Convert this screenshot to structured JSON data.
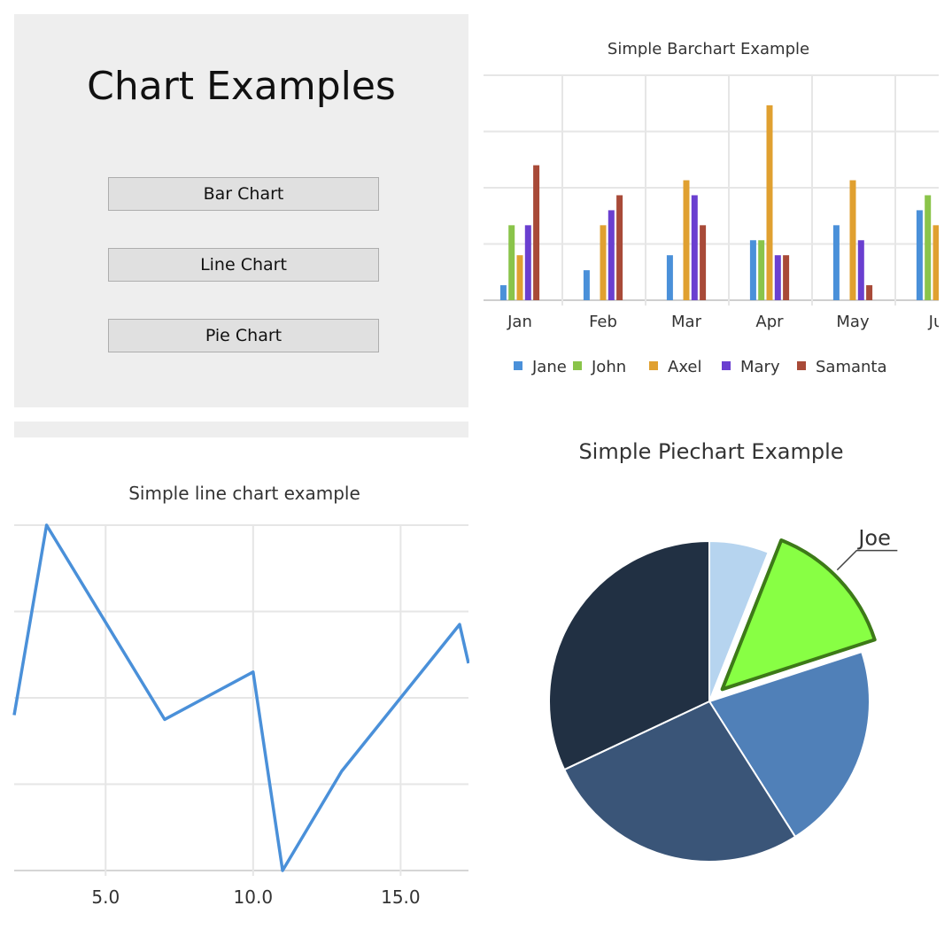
{
  "menu": {
    "title": "Chart Examples",
    "buttons": {
      "bar": "Bar Chart",
      "line": "Line Chart",
      "pie": "Pie Chart"
    }
  },
  "chart_data": [
    {
      "type": "bar",
      "title": "Simple Barchart Example",
      "categories": [
        "Jan",
        "Feb",
        "Mar",
        "Apr",
        "May",
        "Ju"
      ],
      "grid": true,
      "legend_position": "bottom",
      "ylim": [
        0,
        15
      ],
      "series": [
        {
          "name": "Jane",
          "color": "#4a90d9",
          "values": [
            1,
            2,
            3,
            4,
            5,
            6
          ]
        },
        {
          "name": "John",
          "color": "#8ac44a",
          "values": [
            5,
            0,
            0,
            4,
            0,
            7
          ]
        },
        {
          "name": "Axel",
          "color": "#e0a030",
          "values": [
            3,
            5,
            8,
            13,
            8,
            5
          ]
        },
        {
          "name": "Mary",
          "color": "#6a3fd0",
          "values": [
            5,
            6,
            7,
            3,
            4,
            0
          ]
        },
        {
          "name": "Samanta",
          "color": "#a84a38",
          "values": [
            9,
            7,
            5,
            3,
            1,
            0
          ]
        }
      ]
    },
    {
      "type": "line",
      "title": "Simple line chart example",
      "color": "#4a90d9",
      "grid": true,
      "x_ticks": [
        "5.0",
        "10.0",
        "15.0"
      ],
      "xlim": [
        1.9,
        17.3
      ],
      "ylim": [
        1,
        5
      ],
      "points": [
        [
          1.9,
          2.8
        ],
        [
          3,
          5
        ],
        [
          7,
          2.75
        ],
        [
          10,
          3.3
        ],
        [
          11,
          1
        ],
        [
          13,
          2.15
        ],
        [
          17,
          3.85
        ],
        [
          17.3,
          3.4
        ]
      ]
    },
    {
      "type": "pie",
      "title": "Simple Piechart Example",
      "slices": [
        {
          "label": "",
          "value": 6,
          "color": "#b6d4ef"
        },
        {
          "label": "Joe",
          "value": 14,
          "color": "#88ff44",
          "exploded": true
        },
        {
          "label": "",
          "value": 21,
          "color": "#5080b8"
        },
        {
          "label": "",
          "value": 27,
          "color": "#3a5578"
        },
        {
          "label": "",
          "value": 32,
          "color": "#213043"
        }
      ]
    }
  ]
}
